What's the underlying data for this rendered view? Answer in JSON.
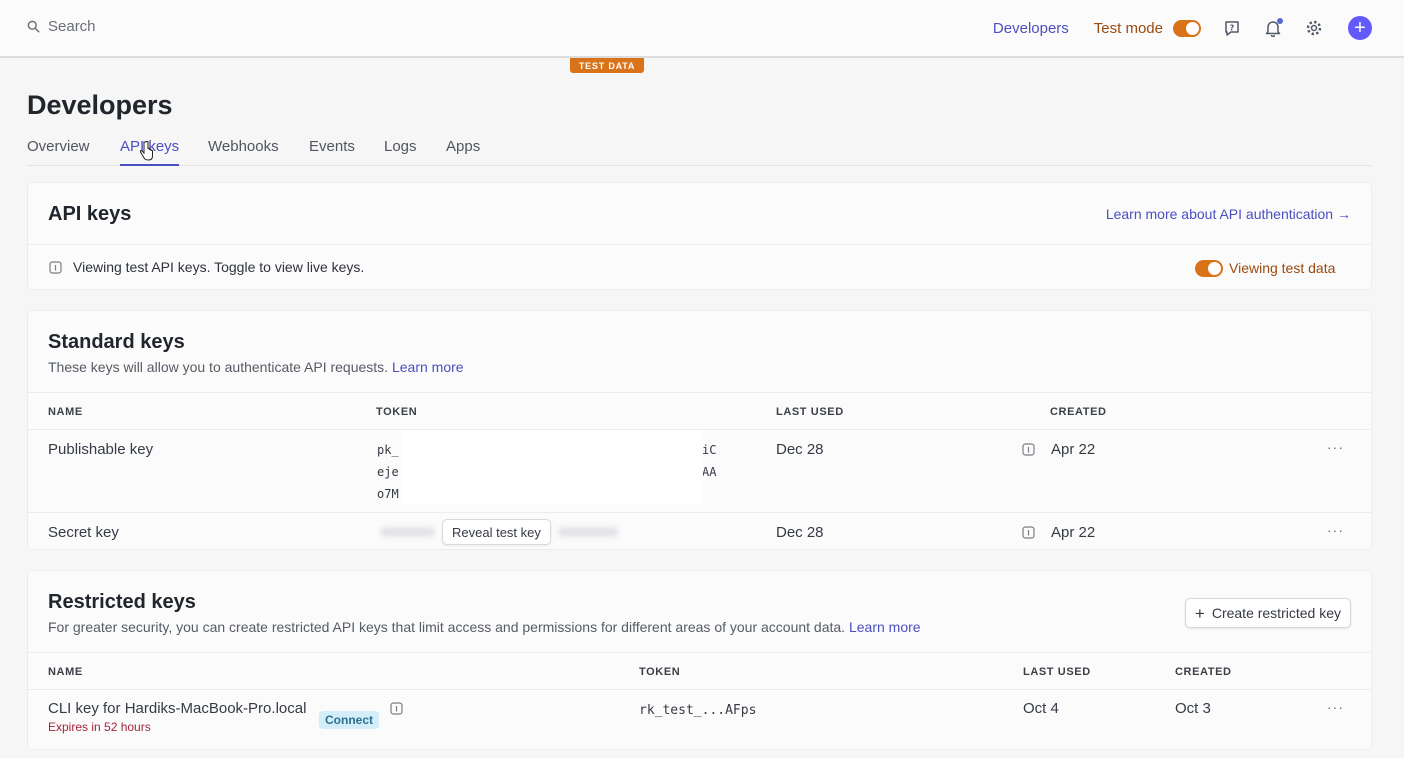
{
  "topbar": {
    "search_placeholder": "Search",
    "developers_label": "Developers",
    "test_mode_label": "Test mode",
    "test_mode_on": true,
    "icons": [
      "help-icon",
      "bell-icon",
      "gear-icon",
      "plus-icon"
    ],
    "accent": "#625afa",
    "test_color": "#d9731a"
  },
  "badge": {
    "test_data": "TEST DATA"
  },
  "page": {
    "title": "Developers",
    "tabs": [
      {
        "label": "Overview"
      },
      {
        "label": "API keys",
        "active": true
      },
      {
        "label": "Webhooks"
      },
      {
        "label": "Events"
      },
      {
        "label": "Logs"
      },
      {
        "label": "Apps"
      }
    ]
  },
  "api_keys": {
    "title": "API keys",
    "learn_more": "Learn more about API authentication →",
    "notice": "Viewing test API keys. Toggle to view live keys.",
    "toggle_label": "Viewing test data"
  },
  "standard_keys": {
    "title": "Standard keys",
    "desc": "These keys will allow you to authenticate API requests.",
    "learn_more": "Learn more",
    "columns": [
      "NAME",
      "TOKEN",
      "LAST USED",
      "CREATED"
    ],
    "rows": [
      {
        "name": "Publishable key",
        "token_lines": [
          {
            "left": "pk_",
            "right": "iC"
          },
          {
            "left": "eje",
            "right": "AA"
          },
          {
            "left": "o7M",
            "right": ""
          }
        ],
        "last_used": "Dec 28",
        "created": "Apr 22"
      },
      {
        "name": "Secret key",
        "reveal_label": "Reveal test key",
        "last_used": "Dec 28",
        "created": "Apr 22"
      }
    ]
  },
  "restricted_keys": {
    "title": "Restricted keys",
    "desc": "For greater security, you can create restricted API keys that limit access and permissions for different areas of your account data.",
    "learn_more": "Learn more",
    "create_label": "Create restricted key",
    "columns": [
      "NAME",
      "TOKEN",
      "LAST USED",
      "CREATED"
    ],
    "rows": [
      {
        "name": "CLI key for Hardiks-MacBook-Pro.local",
        "badge": "Connect",
        "expires": "Expires in 52 hours",
        "token": "rk_test_...AFps",
        "last_used": "Oct 4",
        "created": "Oct 3"
      }
    ]
  },
  "more_label": "···"
}
